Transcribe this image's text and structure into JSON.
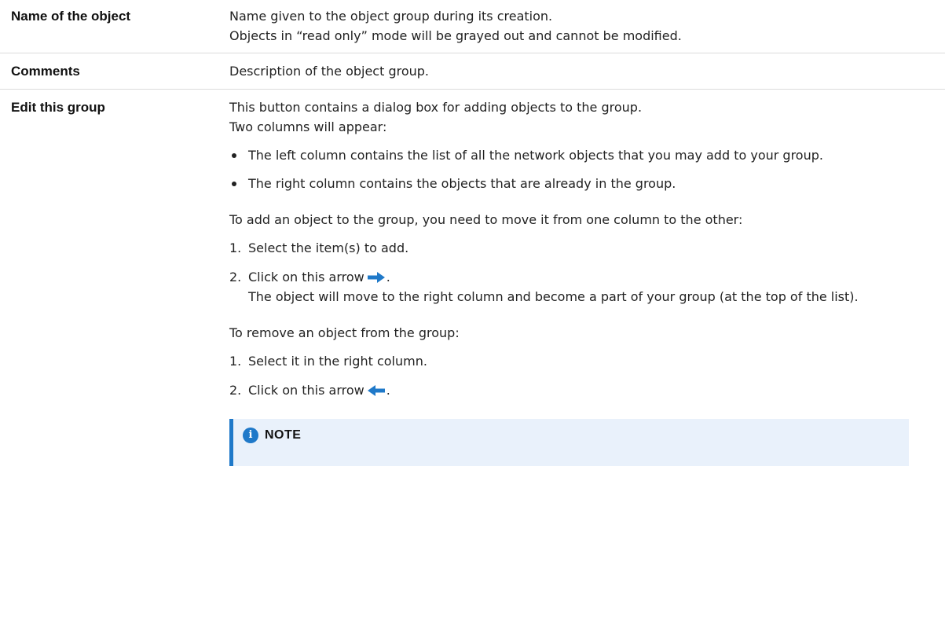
{
  "rows": {
    "name": {
      "label": "Name of the object",
      "line1": "Name given to the object group during its creation.",
      "line2": "Objects in “read only” mode will be grayed out and cannot be modified."
    },
    "comments": {
      "label": "Comments",
      "text": "Description of the object group."
    },
    "edit": {
      "label": "Edit this group",
      "intro1": "This button contains a dialog box for adding objects to the group.",
      "intro2": "Two columns will appear:",
      "bullets": [
        "The left column contains the list of all the network objects that you may add to your group.",
        "The right column contains the objects that are already in the group."
      ],
      "add_intro": "To add an object to the group, you need to move it from one column to the other:",
      "add_steps": [
        {
          "num": "1.",
          "text": "Select the item(s) to add."
        },
        {
          "num": "2.",
          "text": "Click on this arrow",
          "suffix": ".",
          "sub": "The object will move to the right column and become a part of your group (at the top of the list)."
        }
      ],
      "remove_intro": "To remove an object from the group:",
      "remove_steps": [
        {
          "num": "1.",
          "text": "Select it in the right column."
        },
        {
          "num": "2.",
          "text": "Click on this arrow",
          "suffix": "."
        }
      ],
      "note_title": "NOTE"
    }
  },
  "icons": {
    "right_arrow": "arrow-right-icon",
    "left_arrow": "arrow-left-icon",
    "info": "info-icon"
  },
  "colors": {
    "accent": "#1f79c9",
    "note_background": "#e9f1fb",
    "divider": "#dcdcdc"
  }
}
